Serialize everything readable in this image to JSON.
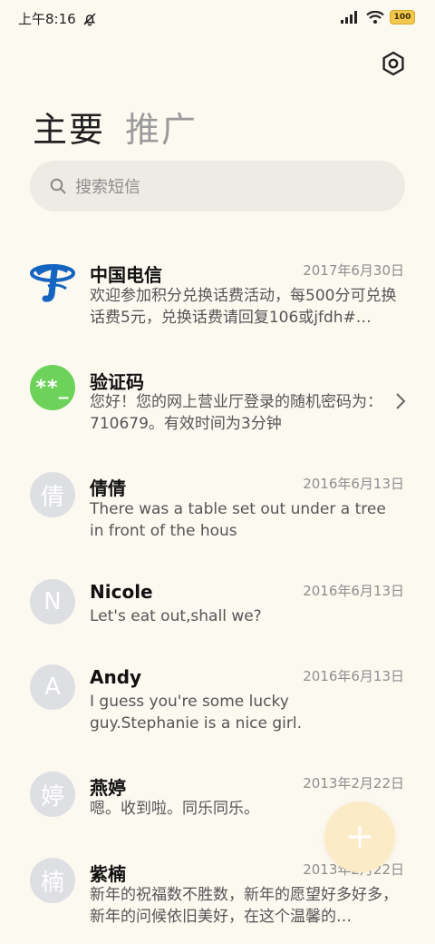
{
  "status_bar": {
    "time": "上午8:16",
    "battery": "100"
  },
  "tabs": [
    {
      "label": "主要"
    },
    {
      "label": "推广"
    }
  ],
  "search": {
    "placeholder": "搜索短信"
  },
  "conversations": [
    {
      "name": "中国电信",
      "date": "2017年6月30日",
      "preview": "欢迎参加积分兑换话费活动，每500分可兑换话费5元，兑换话费请回复106或jfdh#…",
      "avatar": "telecom-logo"
    },
    {
      "name": "验证码",
      "date": "",
      "preview": "您好！您的网上营业厅登录的随机密码为：710679。有效时间为3分钟",
      "avatar_text": "**_"
    },
    {
      "name": "倩倩",
      "date": "2016年6月13日",
      "preview": "There was a table set out under a tree in front of the hous",
      "avatar_text": "倩"
    },
    {
      "name": "Nicole",
      "date": "2016年6月13日",
      "preview": "Let's eat out,shall we?",
      "avatar_text": "N"
    },
    {
      "name": "Andy",
      "date": "2016年6月13日",
      "preview": "I guess you're some lucky guy.Stephanie is a nice girl.",
      "avatar_text": "A"
    },
    {
      "name": "燕婷",
      "date": "2013年2月22日",
      "preview": "嗯。收到啦。同乐同乐。",
      "avatar_text": "婷"
    },
    {
      "name": "紫楠",
      "date": "2013年2月22日",
      "preview": "新年的祝福数不胜数，新年的愿望好多好多，新年的问候依旧美好，在这个温馨的…",
      "avatar_text": "楠"
    }
  ],
  "colors": {
    "background": "#FCF9F1",
    "verification_avatar": "#6CD25A",
    "fab": "#FBEBC6",
    "telecom_blue": "#1565C0"
  }
}
